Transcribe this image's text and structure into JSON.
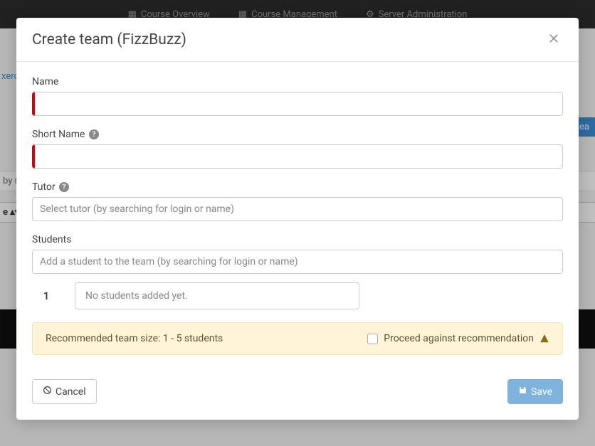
{
  "background": {
    "nav": {
      "course_overview": "Course Overview",
      "course_management": "Course Management",
      "server_admin": "Server Administration"
    },
    "crumb_fragment": "xerc",
    "tea_btn": "tea",
    "by_fragment": "by (",
    "head_fragment": "e"
  },
  "modal": {
    "title": "Create team (FizzBuzz)",
    "fields": {
      "name": {
        "label": "Name",
        "value": ""
      },
      "short_name": {
        "label": "Short Name",
        "value": ""
      },
      "tutor": {
        "label": "Tutor",
        "placeholder": "Select tutor (by searching for login or name)"
      },
      "students": {
        "label": "Students",
        "placeholder": "Add a student to the team (by searching for login or name)"
      }
    },
    "student_slot": {
      "num": "1",
      "empty_text": "No students added yet."
    },
    "recommendation": {
      "text": "Recommended team size: 1 - 5 students",
      "proceed_label": "Proceed against recommendation"
    },
    "buttons": {
      "cancel": "Cancel",
      "save": "Save"
    }
  }
}
